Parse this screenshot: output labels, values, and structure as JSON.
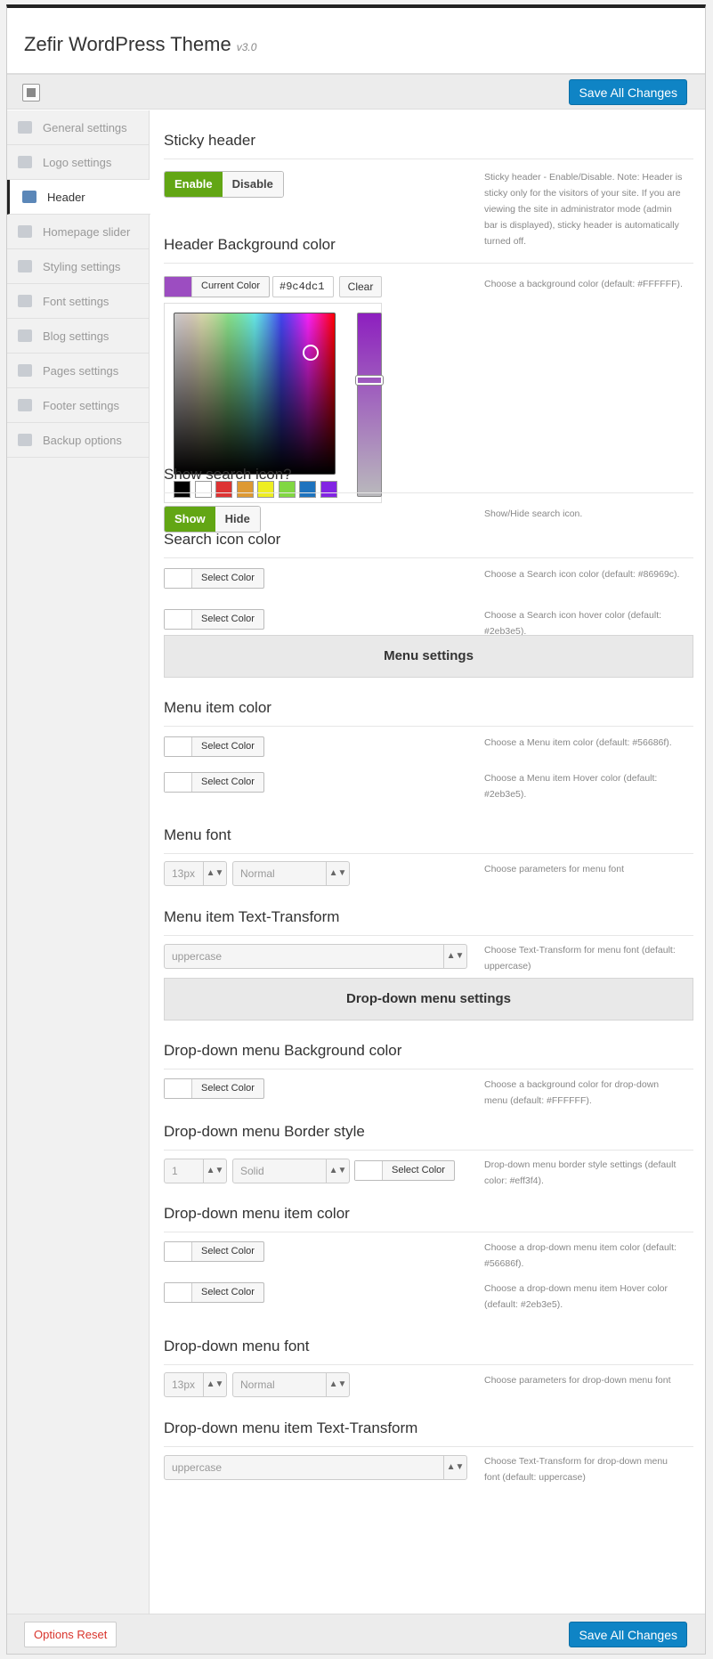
{
  "header": {
    "title": "Zefir WordPress Theme",
    "version": "v3.0"
  },
  "toolbar": {
    "save_label": "Save All Changes"
  },
  "footer": {
    "reset_label": "Options Reset",
    "save_label": "Save All Changes"
  },
  "sidebar": {
    "items": [
      {
        "label": "General settings"
      },
      {
        "label": "Logo settings"
      },
      {
        "label": "Header"
      },
      {
        "label": "Homepage slider"
      },
      {
        "label": "Styling settings"
      },
      {
        "label": "Font settings"
      },
      {
        "label": "Blog settings"
      },
      {
        "label": "Pages settings"
      },
      {
        "label": "Footer settings"
      },
      {
        "label": "Backup options"
      }
    ]
  },
  "sticky": {
    "title": "Sticky header",
    "enable": "Enable",
    "disable": "Disable",
    "desc": "Sticky header - Enable/Disable. Note: Header is sticky only for the visitors of your site. If you are viewing the site in administrator mode (admin bar is displayed), sticky header is automatically turned off."
  },
  "hbg": {
    "title": "Header Background color",
    "current": "Current Color",
    "hex": "#9c4dc1",
    "clear": "Clear",
    "desc": "Choose a background color (default: #FFFFFF).",
    "swatch": "#9c4dc1",
    "palette": [
      "#000000",
      "#ffffff",
      "#dd3333",
      "#dd9933",
      "#eeee22",
      "#81d742",
      "#1e73be",
      "#8224e3"
    ]
  },
  "search": {
    "title": "Show search icon?",
    "show": "Show",
    "hide": "Hide",
    "desc": "Show/Hide search icon."
  },
  "sic": {
    "title": "Search icon color",
    "btn": "Select Color",
    "desc1": "Choose a Search icon color (default: #86969c).",
    "desc2": "Choose a Search icon hover color (default: #2eb3e5)."
  },
  "menu": {
    "block": "Menu settings"
  },
  "mic": {
    "title": "Menu item color",
    "btn": "Select Color",
    "desc1": "Choose a Menu item color (default: #56686f).",
    "desc2": "Choose a Menu item Hover color (default: #2eb3e5)."
  },
  "mf": {
    "title": "Menu font",
    "size": "13px",
    "weight": "Normal",
    "desc": "Choose parameters for menu font"
  },
  "mtt": {
    "title": "Menu item Text-Transform",
    "value": "uppercase",
    "desc": "Choose Text-Transform for menu font (default: uppercase)"
  },
  "dd": {
    "block": "Drop-down menu settings"
  },
  "ddbg": {
    "title": "Drop-down menu Background color",
    "btn": "Select Color",
    "desc": "Choose a background color for drop-down menu (default: #FFFFFF)."
  },
  "ddbs": {
    "title": "Drop-down menu Border style",
    "width": "1",
    "style": "Solid",
    "btn": "Select Color",
    "desc": "Drop-down menu border style settings (default color: #eff3f4)."
  },
  "ddic": {
    "title": "Drop-down menu item color",
    "btn": "Select Color",
    "desc1": "Choose a drop-down menu item color (default: #56686f).",
    "desc2": "Choose a drop-down menu item Hover color (default: #2eb3e5)."
  },
  "ddf": {
    "title": "Drop-down menu font",
    "size": "13px",
    "weight": "Normal",
    "desc": "Choose parameters for drop-down menu font"
  },
  "ddtt": {
    "title": "Drop-down menu item Text-Transform",
    "value": "uppercase",
    "desc": "Choose Text-Transform for drop-down menu font (default: uppercase)"
  }
}
